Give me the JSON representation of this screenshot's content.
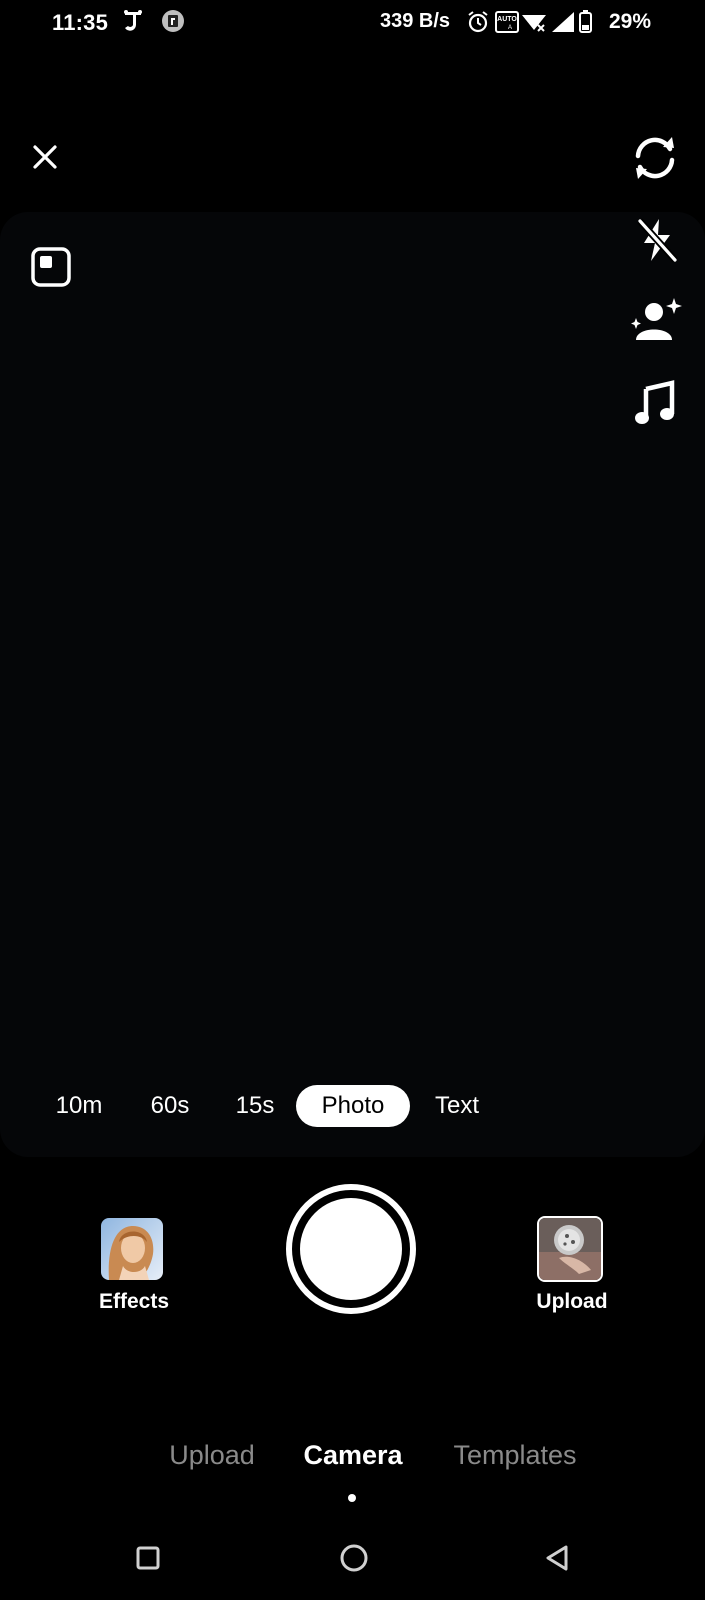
{
  "status_bar": {
    "time": "11:35",
    "network_speed": "339 B/s",
    "battery_percent": "29%",
    "icons": [
      "app-notification-icon",
      "app-notification-icon-2",
      "alarm-icon",
      "auto-brightness-icon",
      "wifi-icon",
      "signal-icon",
      "battery-icon"
    ]
  },
  "top_controls": {
    "icons": [
      "close-icon",
      "aspect-ratio-icon",
      "flip-camera-icon",
      "flash-off-icon",
      "beauty-icon",
      "music-icon"
    ]
  },
  "capture_modes": {
    "items": [
      "10m",
      "60s",
      "15s",
      "Photo",
      "Text"
    ],
    "selected": "Photo"
  },
  "capture": {
    "effects_label": "Effects",
    "upload_label": "Upload"
  },
  "bottom_tabs": {
    "items": [
      "Upload",
      "Camera",
      "Templates"
    ],
    "selected": "Camera"
  },
  "nav_bar": {
    "icons": [
      "recents-icon",
      "home-icon",
      "back-icon"
    ]
  },
  "colors": {
    "background": "#000000",
    "viewfinder": "#050608",
    "inactive_tab": "#8a8a8a",
    "foreground": "#ffffff"
  }
}
